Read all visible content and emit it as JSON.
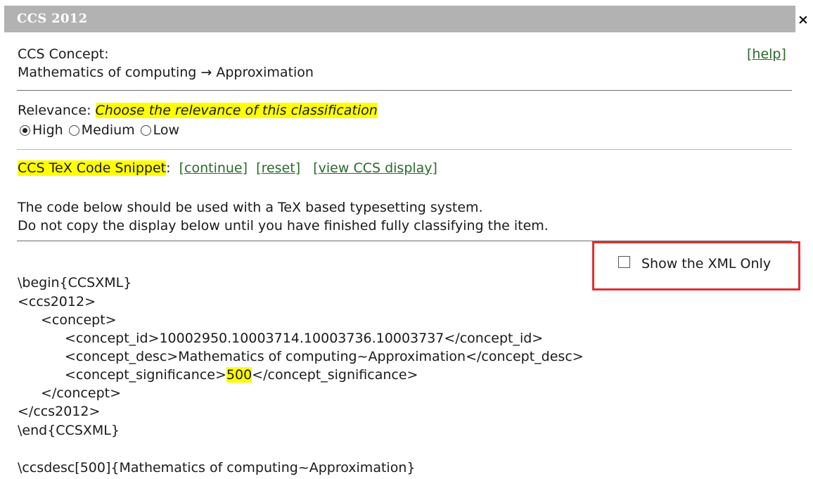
{
  "dialog": {
    "title": "CCS 2012",
    "close_label": "×"
  },
  "concept": {
    "label": "CCS Concept:",
    "path": "Mathematics of computing → Approximation",
    "help_label": "help"
  },
  "relevance": {
    "label": "Relevance:",
    "prompt": "Choose the relevance of this classification",
    "options": [
      {
        "label": "High",
        "checked": true
      },
      {
        "label": "Medium",
        "checked": false
      },
      {
        "label": "Low",
        "checked": false
      }
    ]
  },
  "snippet": {
    "title": "CCS TeX Code Snippet",
    "colon": ":",
    "continue_label": "continue",
    "reset_label": "reset",
    "view_label": "view CCS display"
  },
  "notes": {
    "line1": "The code below should be used with a TeX based typesetting system.",
    "line2": "Do not copy the display below until you have finished fully classifying the item."
  },
  "xml_only": {
    "label": "Show the XML Only",
    "checked": false
  },
  "code": {
    "begin": "\\begin{CCSXML}",
    "ccs_open": "<ccs2012>",
    "concept_open": "<concept>",
    "concept_id": "<concept_id>10002950.10003714.10003736.10003737</concept_id>",
    "concept_desc": "<concept_desc>Mathematics of computing~Approximation</concept_desc>",
    "sig_open": "<concept_significance>",
    "sig_value": "500",
    "sig_close": "</concept_significance>",
    "concept_close": "</concept>",
    "ccs_close": "</ccs2012>",
    "end": "\\end{CCSXML}",
    "ccsdesc": "\\ccsdesc[500]{Mathematics of computing~Approximation}"
  },
  "colors": {
    "titlebar": "#b2b2b2",
    "highlight": "#ffff00",
    "link": "#2a6a2a",
    "callout_border": "#e03030"
  }
}
